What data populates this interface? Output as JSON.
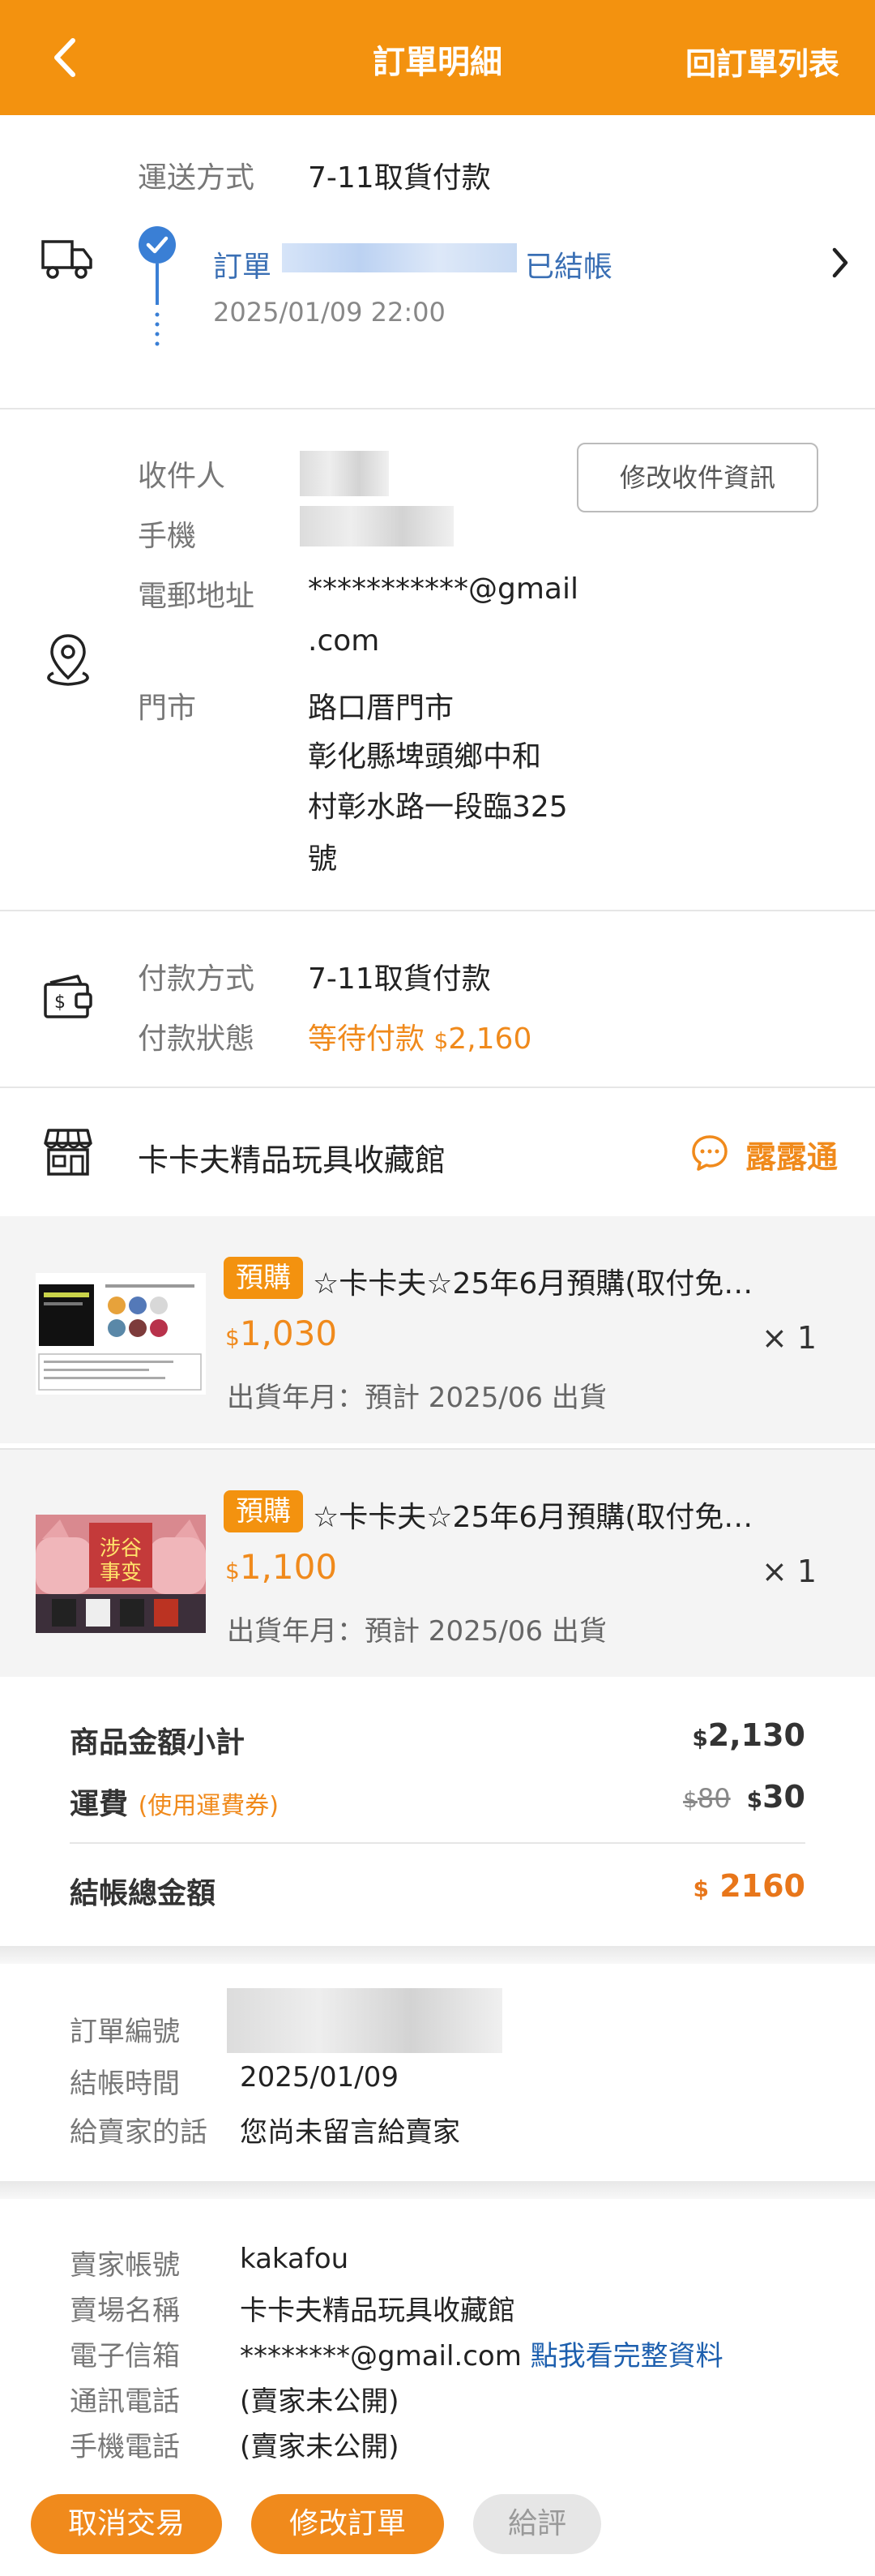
{
  "header": {
    "title": "訂單明細",
    "back_link": "回訂單列表"
  },
  "shipping": {
    "method_label": "運送方式",
    "method_value": "7-11取貨付款",
    "order_prefix": "訂單",
    "order_status": "已結帳",
    "order_time": "2025/01/09 22:00"
  },
  "recipient": {
    "name_label": "收件人",
    "phone_label": "手機",
    "email_label": "電郵地址",
    "email_line1": "***********@gmail",
    "email_line2": ".com",
    "store_label": "門市",
    "store_line1": "路口厝門市",
    "store_line2": "彰化縣埤頭鄉中和",
    "store_line3": "村彰水路一段臨325",
    "store_line4": "號",
    "edit_button": "修改收件資訊"
  },
  "payment": {
    "method_label": "付款方式",
    "method_value": "7-11取貨付款",
    "status_label": "付款狀態",
    "status_value": "等待付款",
    "currency": "$",
    "amount": "2,160"
  },
  "shop": {
    "name": "卡卡夫精品玩具收藏館",
    "chat_label": "露露通"
  },
  "items": [
    {
      "badge": "預購",
      "title": "☆卡卡夫☆25年6月預購(取付免…",
      "currency": "$",
      "price": "1,030",
      "qty": "× 1",
      "ship": "出貨年月：預計 2025/06 出貨"
    },
    {
      "badge": "預購",
      "title": "☆卡卡夫☆25年6月預購(取付免…",
      "currency": "$",
      "price": "1,100",
      "qty": "× 1",
      "ship": "出貨年月：預計 2025/06 出貨"
    }
  ],
  "summary": {
    "subtotal_label": "商品金額小計",
    "subtotal_value": "2,130",
    "shipping_label": "運費",
    "shipping_note": "(使用運費券)",
    "shipping_original": "80",
    "shipping_value": "30",
    "total_label": "結帳總金額",
    "total_value": "2160",
    "currency": "$"
  },
  "order_info": {
    "number_label": "訂單編號",
    "time_label": "結帳時間",
    "time_value": "2025/01/09",
    "message_label": "給賣家的話",
    "message_value": "您尚未留言給賣家"
  },
  "seller": {
    "account_label": "賣家帳號",
    "account_value": "kakafou",
    "shop_label": "賣場名稱",
    "shop_value": "卡卡夫精品玩具收藏館",
    "email_label": "電子信箱",
    "email_value": "********@gmail.com",
    "email_link": "點我看完整資料",
    "tel_label": "通訊電話",
    "tel_value": "(賣家未公開)",
    "mobile_label": "手機電話",
    "mobile_value": "(賣家未公開)"
  },
  "buttons": {
    "cancel": "取消交易",
    "modify": "修改訂單",
    "rate": "給評"
  },
  "colors": {
    "brand": "#f3920f",
    "accent_orange": "#f08a1c",
    "link_blue": "#3a6fb4"
  }
}
